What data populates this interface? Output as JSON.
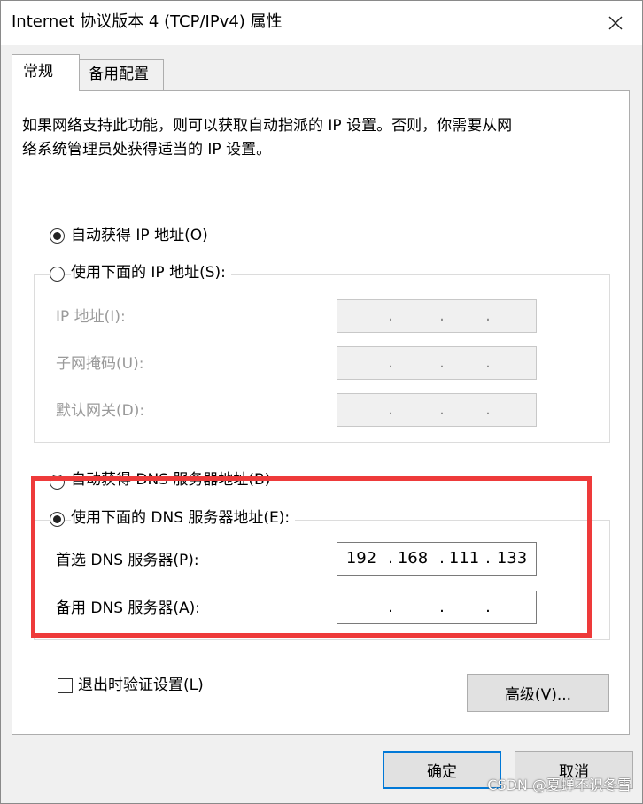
{
  "window": {
    "title": "Internet 协议版本 4 (TCP/IPv4) 属性"
  },
  "tabs": [
    {
      "label": "常规",
      "active": true
    },
    {
      "label": "备用配置",
      "active": false
    }
  ],
  "description": {
    "line1": "如果网络支持此功能，则可以获取自动指派的 IP 设置。否则，你需要从网",
    "line2": "络系统管理员处获得适当的 IP 设置。"
  },
  "ip_section": {
    "auto_label": "自动获得 IP 地址(O)",
    "auto_checked": true,
    "manual_label": "使用下面的 IP 地址(S):",
    "manual_checked": false,
    "fields": [
      {
        "label": "IP 地址(I):",
        "value": [
          "",
          "",
          "",
          ""
        ]
      },
      {
        "label": "子网掩码(U):",
        "value": [
          "",
          "",
          "",
          ""
        ]
      },
      {
        "label": "默认网关(D):",
        "value": [
          "",
          "",
          "",
          ""
        ]
      }
    ]
  },
  "dns_section": {
    "auto_label": "自动获得 DNS 服务器地址(B)",
    "auto_checked": false,
    "manual_label": "使用下面的 DNS 服务器地址(E):",
    "manual_checked": true,
    "fields": [
      {
        "label": "首选 DNS 服务器(P):",
        "value": [
          "192",
          "168",
          "111",
          "133"
        ]
      },
      {
        "label": "备用 DNS 服务器(A):",
        "value": [
          "",
          "",
          "",
          ""
        ]
      }
    ]
  },
  "validate_label": "退出时验证设置(L)",
  "validate_checked": false,
  "buttons": {
    "advanced": "高级(V)...",
    "ok": "确定",
    "cancel": "取消"
  },
  "watermark": "CSDN @夏蝉不识冬雪",
  "colors": {
    "highlight": "#ee3a3a",
    "primary_button_border": "#0078d7"
  }
}
